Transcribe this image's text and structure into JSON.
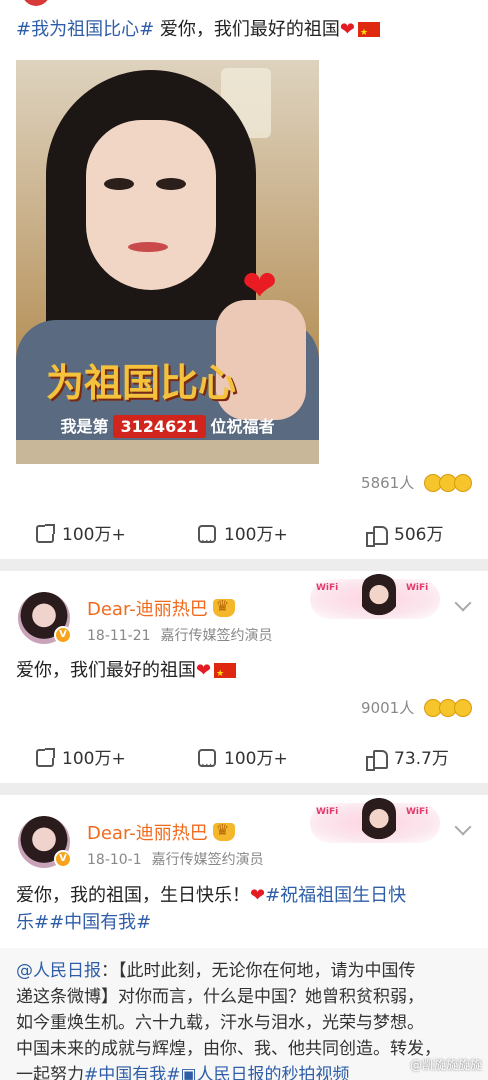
{
  "post1": {
    "hashtag": "#我为祖国比心#",
    "text": " 爱你，我们最好的祖国",
    "image": {
      "slogan": "为祖国比心",
      "counter_prefix": "我是第",
      "counter_number": "3124621",
      "counter_suffix": "位祝福者"
    },
    "reactions_count": "5861人",
    "share_count": "100万+",
    "comment_count": "100万+",
    "like_count": "506万"
  },
  "post2": {
    "username": "Dear-迪丽热巴",
    "date": "18-11-21",
    "source": "嘉行传媒签约演员",
    "text": "爱你，我们最好的祖国",
    "reactions_count": "9001人",
    "share_count": "100万+",
    "comment_count": "100万+",
    "like_count": "73.7万"
  },
  "post3": {
    "username": "Dear-迪丽热巴",
    "date": "18-10-1",
    "source": "嘉行传媒签约演员",
    "text_line1_plain": "爱你，我的祖国，生日快乐！",
    "text_line1_hashtag": "#祝福祖国生日快",
    "text_line2_hashtag1": "乐#",
    "text_line2_hashtag2": "#中国有我#",
    "quoted": {
      "mention": "@人民日报",
      "line1_rest": "：【此时此刻，无论你在何地，请为中国传",
      "line2": "递这条微博】对你而言，什么是中国？她曾积贫积弱，",
      "line3": "如今重焕生机。六十九载，汗水与泪水，光荣与梦想。",
      "line4": "中国未来的成就与辉煌，由你、我、他共同创造。转发，",
      "line5_plain": "一起努力",
      "line5_hashtag": "#中国有我#",
      "line5_link": "人民日报的秒拍视频"
    }
  },
  "deco_tag": "WiFi",
  "watermark": "@凯旋旋旋旋"
}
